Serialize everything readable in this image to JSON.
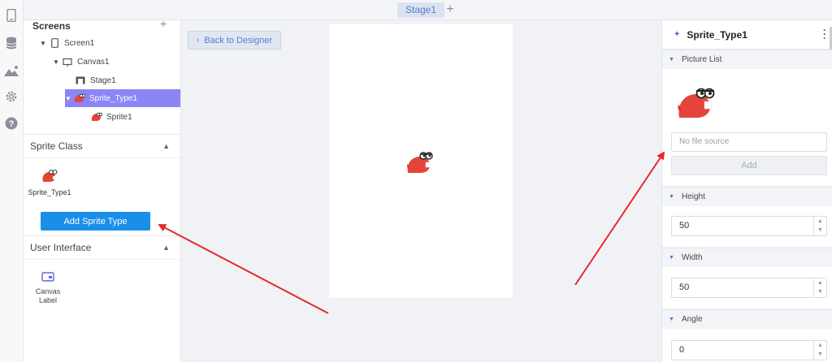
{
  "topbar": {
    "stage_tab": "Stage1",
    "add_tab": "+"
  },
  "screens": {
    "title": "Screens",
    "add": "+",
    "tree": [
      {
        "label": "Screen1"
      },
      {
        "label": "Canvas1"
      },
      {
        "label": "Stage1"
      },
      {
        "label": "Sprite_Type1"
      },
      {
        "label": "Sprite1"
      }
    ]
  },
  "sprite_class": {
    "title": "Sprite Class",
    "item_label": "Sprite_Type1",
    "add_button": "Add Sprite Type"
  },
  "user_interface": {
    "title": "User Interface",
    "item_line1": "Canvas",
    "item_line2": "Label"
  },
  "center": {
    "back_button": "Back to Designer"
  },
  "properties": {
    "title": "Sprite_Type1",
    "picture_list": {
      "title": "Picture List",
      "file_placeholder": "No file source",
      "add_button": "Add"
    },
    "height": {
      "title": "Height",
      "value": "50"
    },
    "width": {
      "title": "Width",
      "value": "50"
    },
    "angle": {
      "title": "Angle",
      "value": "0"
    }
  },
  "colors": {
    "accent": "#1a8fe8",
    "selected_row": "#8b85f5",
    "sprite_red": "#e5443b",
    "arrow_red": "#e8262d"
  }
}
